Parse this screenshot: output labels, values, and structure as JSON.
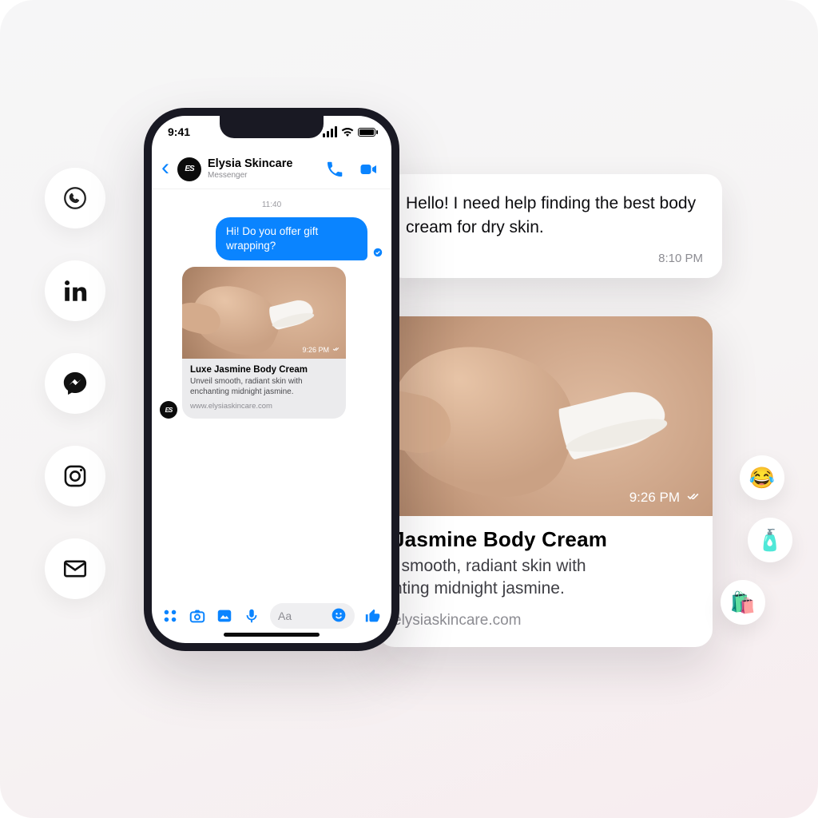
{
  "channels": [
    "whatsapp",
    "linkedin",
    "messenger",
    "instagram",
    "email"
  ],
  "chips": [
    "😂",
    "🧴",
    "🛍️"
  ],
  "phone": {
    "status_time": "9:41",
    "wifi": true
  },
  "header": {
    "contact_name": "Elysia Skincare",
    "contact_sub": "Messenger",
    "avatar_initials": "ES"
  },
  "thread": {
    "timestamp": "11:40",
    "sent_text": "Hi! Do you offer gift wrapping?",
    "card": {
      "title": "Luxe Jasmine Body Cream",
      "desc": "Unveil smooth, radiant skin with enchanting midnight jasmine.",
      "url": "www.elysiaskincare.com",
      "img_time": "9:26 PM"
    }
  },
  "composer": {
    "placeholder": "Aa"
  },
  "external_message": {
    "text": "Hello! I need help finding the best body cream for dry skin.",
    "time": "8:10 PM"
  },
  "external_card": {
    "title_visible": "Jasmine Body Cream",
    "desc_line1_visible": "l smooth, radiant skin with",
    "desc_line2_visible": "nting midnight jasmine.",
    "url_visible": "elysiaskincare.com",
    "img_time": "9:26 PM"
  }
}
